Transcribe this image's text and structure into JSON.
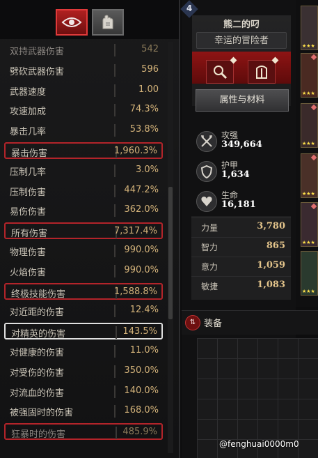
{
  "tabs": {
    "active": "eye-icon",
    "items": [
      {
        "icon": "eye-icon",
        "color": "#c42828"
      },
      {
        "icon": "hand-icon",
        "color": "#4a4a4a"
      }
    ]
  },
  "stats": [
    {
      "name": "双持武器伤害",
      "value": "542",
      "style": "faded"
    },
    {
      "name": "劈砍武器伤害",
      "value": "596"
    },
    {
      "name": "武器速度",
      "value": "1.00"
    },
    {
      "name": "攻速加成",
      "value": "74.3%"
    },
    {
      "name": "暴击几率",
      "value": "53.8%"
    },
    {
      "name": "暴击伤害",
      "value": "1,960.3%",
      "style": "highlight"
    },
    {
      "name": "压制几率",
      "value": "3.0%"
    },
    {
      "name": "压制伤害",
      "value": "447.2%"
    },
    {
      "name": "易伤伤害",
      "value": "362.0%"
    },
    {
      "name": "所有伤害",
      "value": "7,317.4%",
      "style": "highlight"
    },
    {
      "name": "物理伤害",
      "value": "990.0%"
    },
    {
      "name": "火焰伤害",
      "value": "990.0%"
    },
    {
      "name": "终极技能伤害",
      "value": "1,588.8%",
      "style": "highlight"
    },
    {
      "name": "对近距的伤害",
      "value": "12.4%"
    },
    {
      "name": "对精英的伤害",
      "value": "143.5%",
      "style": "selected"
    },
    {
      "name": "对健康的伤害",
      "value": "11.0%"
    },
    {
      "name": "对受伤的伤害",
      "value": "350.0%"
    },
    {
      "name": "对流血的伤害",
      "value": "140.0%"
    },
    {
      "name": "被强固时的伤害",
      "value": "168.0%"
    },
    {
      "name": "狂暴时的伤害",
      "value": "485.9%",
      "style": "highlight"
    }
  ],
  "character": {
    "level": "4",
    "name": "熊二的叼",
    "title": "幸运的冒险者",
    "materials_label": "属性与材料",
    "core": [
      {
        "label": "攻强",
        "value": "349,664",
        "icon": "swords-icon"
      },
      {
        "label": "护甲",
        "value": "1,634",
        "icon": "shield-icon"
      },
      {
        "label": "生命",
        "value": "16,181",
        "icon": "heart-icon"
      }
    ],
    "attributes": [
      {
        "name": "力量",
        "value": "3,780"
      },
      {
        "name": "智力",
        "value": "865"
      },
      {
        "name": "意力",
        "value": "1,059"
      },
      {
        "name": "敏捷",
        "value": "1,083"
      }
    ]
  },
  "equipment": {
    "title": "装备"
  },
  "watermark": "@fenghuai0000m0",
  "colors": {
    "highlight_border": "#b3242a",
    "selected_border": "#e0e0e0",
    "value_gold": "#d4b37a",
    "accent_red": "#8e1414"
  }
}
